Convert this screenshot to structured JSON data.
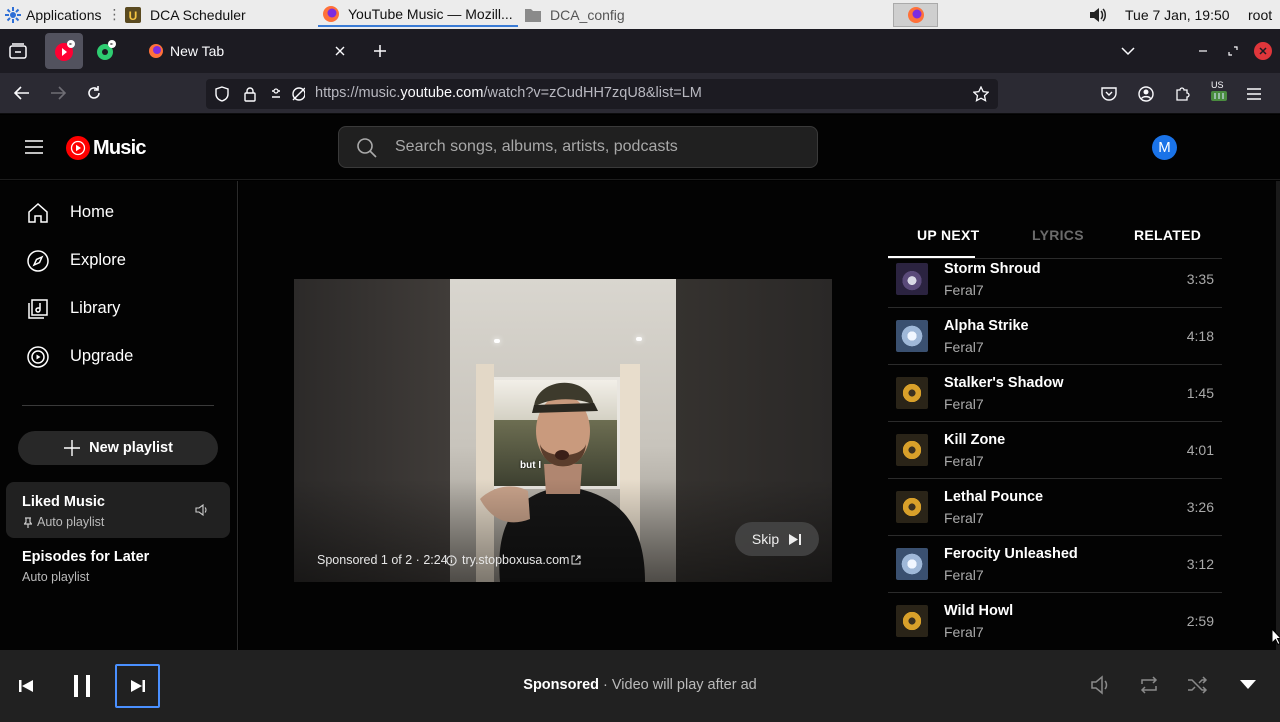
{
  "taskbar": {
    "applications_label": "Applications",
    "windows": [
      {
        "label": "DCA Scheduler"
      },
      {
        "label": "YouTube Music — Mozill..."
      },
      {
        "label": "DCA_config"
      }
    ],
    "clock": "Tue  7 Jan, 19:50",
    "user": "root"
  },
  "browser": {
    "tab_label": "New Tab",
    "url_prefix": "https://music.",
    "url_host": "youtube.com",
    "url_path": "/watch?v=zCudHH7zqU8&list=LM",
    "keyboard_layout": "US"
  },
  "ytm": {
    "logo_text": "Music",
    "search_placeholder": "Search songs, albums, artists, podcasts",
    "avatar_letter": "M",
    "nav": [
      {
        "label": "Home",
        "icon": "home-icon"
      },
      {
        "label": "Explore",
        "icon": "explore-icon"
      },
      {
        "label": "Library",
        "icon": "library-icon"
      },
      {
        "label": "Upgrade",
        "icon": "upgrade-icon"
      }
    ],
    "new_playlist_label": "New playlist",
    "playlists": [
      {
        "title": "Liked Music",
        "subtitle": "Auto playlist"
      },
      {
        "title": "Episodes for Later",
        "subtitle": "Auto playlist"
      }
    ],
    "tabs": {
      "up_next": "UP NEXT",
      "lyrics": "LYRICS",
      "related": "RELATED"
    },
    "ad": {
      "caption": "but I",
      "sponsored_info": "Sponsored 1 of 2 · 2:24",
      "link": "try.stopboxusa.com",
      "skip_label": "Skip"
    },
    "queue": [
      {
        "title": "Storm Shroud",
        "artist": "Feral7",
        "duration": "3:35",
        "art": "blue"
      },
      {
        "title": "Alpha Strike",
        "artist": "Feral7",
        "duration": "4:18",
        "art": "ice"
      },
      {
        "title": "Stalker's Shadow",
        "artist": "Feral7",
        "duration": "1:45",
        "art": "gold"
      },
      {
        "title": "Kill Zone",
        "artist": "Feral7",
        "duration": "4:01",
        "art": "gold"
      },
      {
        "title": "Lethal Pounce",
        "artist": "Feral7",
        "duration": "3:26",
        "art": "gold"
      },
      {
        "title": "Ferocity Unleashed",
        "artist": "Feral7",
        "duration": "3:12",
        "art": "ice"
      },
      {
        "title": "Wild Howl",
        "artist": "Feral7",
        "duration": "2:59",
        "art": "gold"
      }
    ],
    "player": {
      "status_bold": "Sponsored",
      "status_text": " · Video will play after ad"
    }
  },
  "colors": {
    "ytm_red": "#ff0000",
    "avatar_blue": "#1a73e8",
    "background": "#030303",
    "player_bar": "#212121"
  }
}
